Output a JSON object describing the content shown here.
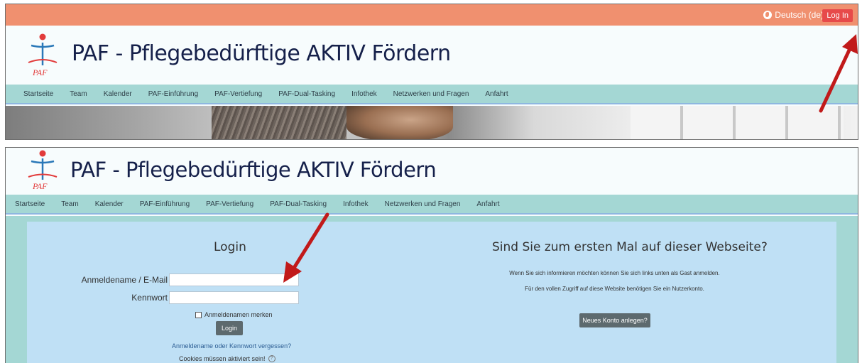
{
  "topbar": {
    "language": "Deutsch (de)",
    "login_link": "Log In"
  },
  "site": {
    "title": "PAF - Pflegebedürftige AKTIV Fördern",
    "logo_text": "PAF"
  },
  "nav": {
    "items": [
      "Startseite",
      "Team",
      "Kalender",
      "PAF-Einführung",
      "PAF-Vertiefung",
      "PAF-Dual-Tasking",
      "Infothek",
      "Netzwerken und Fragen",
      "Anfahrt"
    ]
  },
  "login": {
    "heading": "Login",
    "username_label": "Anmeldename / E-Mail",
    "password_label": "Kennwort",
    "username_value": "",
    "password_value": "",
    "remember_label": "Anmeldenamen merken",
    "submit_label": "Login",
    "forgot_link": "Anmeldename oder Kennwort vergessen?",
    "cookies_note": "Cookies müssen aktiviert sein!",
    "help_glyph": "?"
  },
  "guest": {
    "heading": "Sind Sie zum ersten Mal auf dieser Webseite?",
    "text_1": "Wenn Sie sich informieren möchten können Sie sich links unten als Gast anmelden.",
    "text_2": "Für den vollen Zugriff auf diese Website benötigen Sie ein Nutzerkonto.",
    "new_account_button": "Neues Konto anlegen?"
  },
  "colors": {
    "topbar": "#f0906f",
    "nav": "#a4d7d4",
    "login_box": "#bfe0f5",
    "title": "#15204a",
    "arrow": "#c11a1a"
  },
  "icons": [
    "globe-icon",
    "paf-logo",
    "help-icon",
    "annotation-arrow"
  ]
}
